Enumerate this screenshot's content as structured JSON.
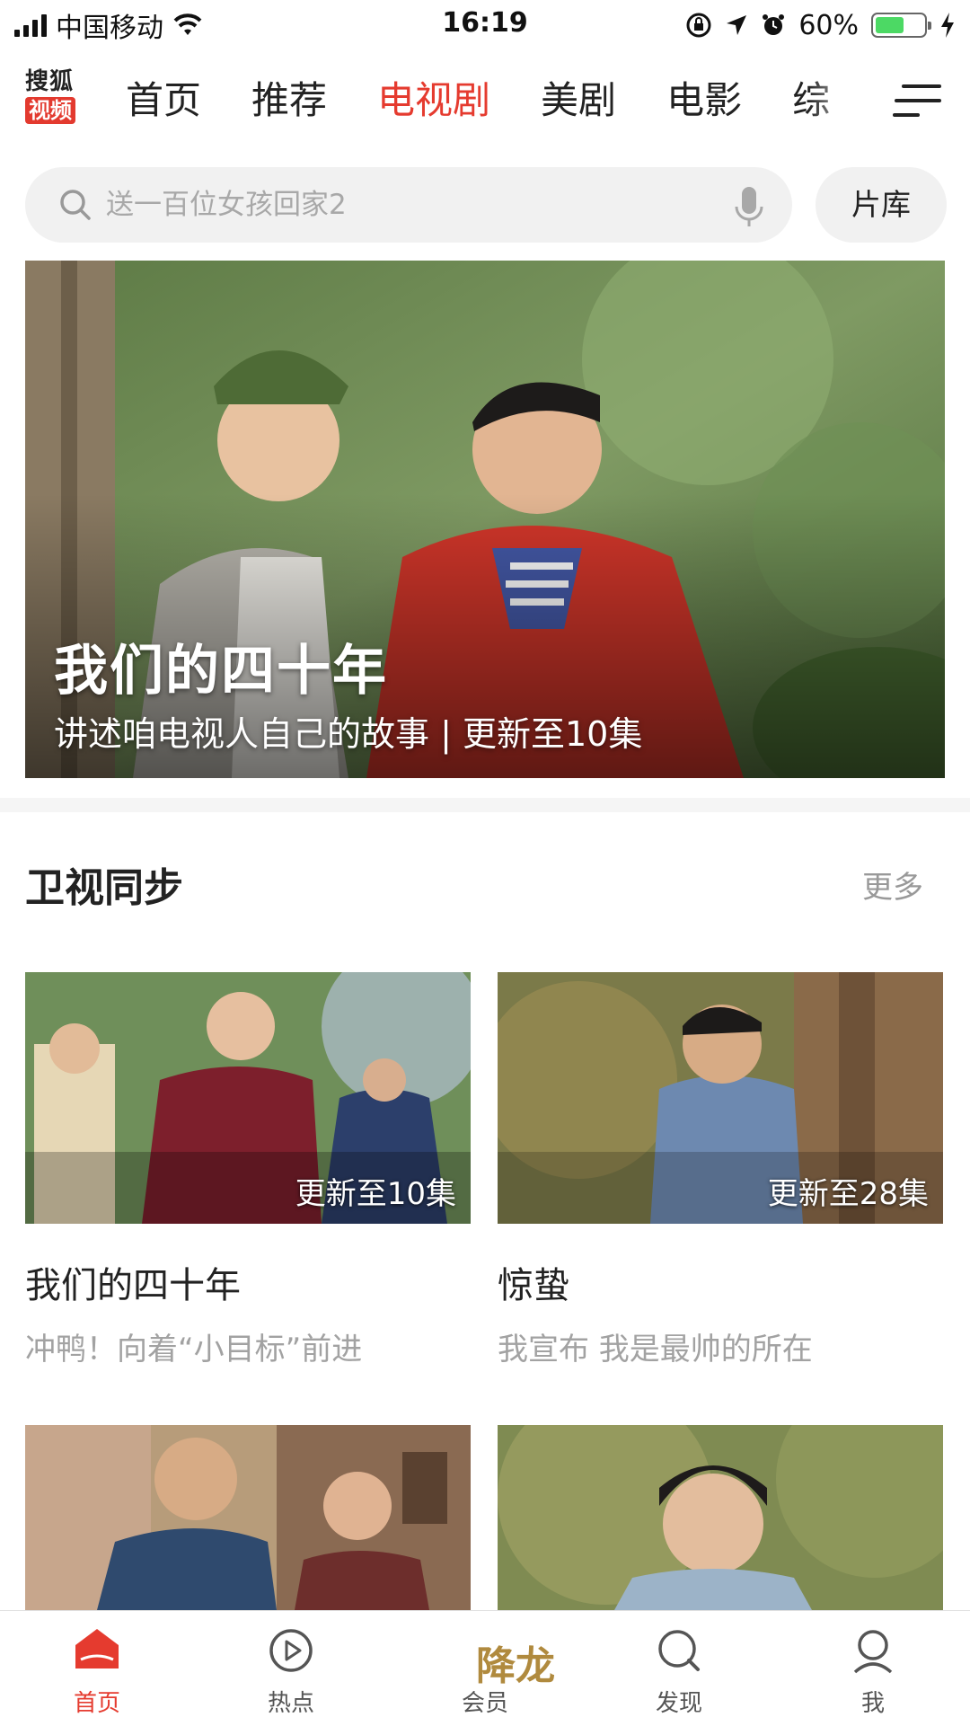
{
  "status_bar": {
    "carrier": "中国移动",
    "time": "16:19",
    "battery": "60%",
    "battery_level": 0.6,
    "icons": [
      "signal-icon",
      "wifi-icon",
      "orientation-lock-icon",
      "location-icon",
      "alarm-icon",
      "battery-icon",
      "charging-icon"
    ]
  },
  "header": {
    "logo_line1": "搜狐",
    "logo_line2": "视频",
    "tabs": [
      "首页",
      "推荐",
      "电视剧",
      "美剧",
      "电影",
      "综"
    ],
    "active_tab": "电视剧",
    "accent_color": "#e53b2f"
  },
  "search": {
    "placeholder": "送一百位女孩回家2",
    "library_label": "片库"
  },
  "banner": {
    "title": "我们的四十年",
    "subtitle": "讲述咱电视人自己的故事 | 更新至10集"
  },
  "section": {
    "title": "卫视同步",
    "more": "更多",
    "cards": [
      {
        "badge": "更新至10集",
        "title": "我们的四十年",
        "desc": "冲鸭！向着“小目标”前进"
      },
      {
        "badge": "更新至28集",
        "title": "惊蛰",
        "desc": "我宣布 我是最帅的所在"
      }
    ]
  },
  "tab_bar": {
    "items": [
      "首页",
      "热点",
      "会员",
      "发现",
      "我"
    ],
    "vip_logo_text": "降龙",
    "active": "首页"
  }
}
